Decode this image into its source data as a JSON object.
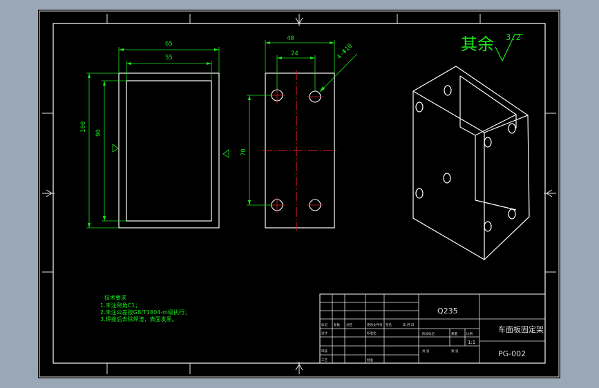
{
  "surface_note": {
    "label": "其余",
    "roughness": "3.2"
  },
  "front_view": {
    "dims": {
      "outer_width": "65",
      "inner_width": "55",
      "outer_height": "100",
      "inner_height": "90"
    }
  },
  "side_view": {
    "dims": {
      "width": "40",
      "hole_spacing_h": "24",
      "hole_diameter": "4-Φ10",
      "hole_spacing_v": "70"
    }
  },
  "tech_notes": {
    "title": "技术要求",
    "lines": [
      "1.未注倒角C1；",
      "2.未注公差按GB/T1804-m级执行；",
      "3.焊接后去除焊渣，表面发黑。"
    ]
  },
  "title_block": {
    "material": "Q235",
    "part_name": "车面板固定架",
    "drawing_no": "PG-002",
    "scale": "1:1",
    "labels": [
      "标记",
      "处数",
      "分区",
      "更改文件号",
      "签名",
      "年.月.日",
      "设计",
      "标准化",
      "审核",
      "工艺",
      "批准",
      "阶段标记",
      "重量",
      "比例",
      "共 张",
      "第 张"
    ]
  }
}
